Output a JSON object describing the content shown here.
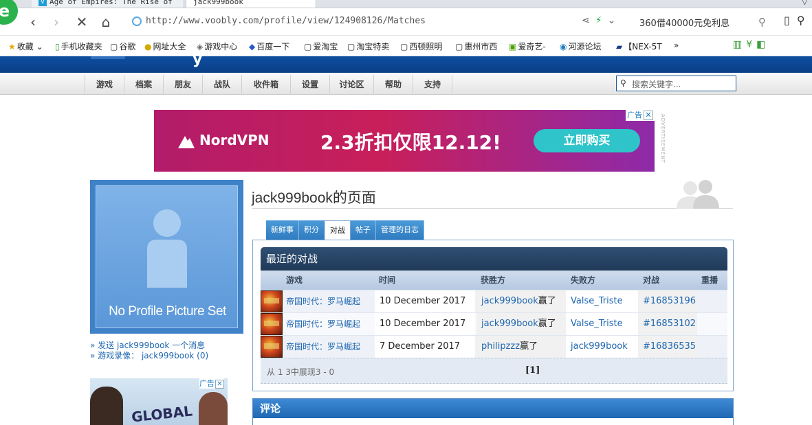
{
  "browser": {
    "tabs": [
      "Age of Empires: The Rise of",
      "jack999book"
    ],
    "address": "http://www.voobly.com/profile/view/124908126/Matches",
    "search_text": "360借40000元免利息",
    "bookmarks": [
      {
        "icon": "★",
        "label": "收藏"
      },
      {
        "icon": "▯",
        "label": "手机收藏夹"
      },
      {
        "icon": "▢",
        "label": "谷歌"
      },
      {
        "icon": "●",
        "label": "网址大全"
      },
      {
        "icon": "◈",
        "label": "游戏中心"
      },
      {
        "icon": "◆",
        "label": "百度一下"
      },
      {
        "icon": "▢",
        "label": "爱淘宝"
      },
      {
        "icon": "▢",
        "label": "淘宝特卖"
      },
      {
        "icon": "▢",
        "label": "西顿照明"
      },
      {
        "icon": "▢",
        "label": "惠州市西"
      },
      {
        "icon": "▣",
        "label": "爱奇艺-"
      },
      {
        "icon": "◉",
        "label": "河源论坛"
      },
      {
        "icon": "▰",
        "label": "【NEX-5T"
      }
    ],
    "more": "»"
  },
  "site": {
    "menu": [
      "游戏",
      "档案",
      "朋友",
      "战队",
      "收件箱",
      "设置",
      "讨论区",
      "帮助",
      "支持"
    ],
    "search_placeholder": "搜索关键字..."
  },
  "ad": {
    "brand": "NordVPN",
    "promo": "2.3折扣仅限12.12!",
    "button": "立即购买",
    "tag": "广告",
    "vertical": "ADVERTISEMENT",
    "ad2_text": "GLOBAL",
    "ad2_tag": "广告"
  },
  "profile": {
    "no_picture": "No Profile Picture Set",
    "links": [
      "» 发送 jack999book 一个消息",
      "» 游戏录像： jack999book (0)"
    ],
    "title": "jack999book的页面",
    "tabs": [
      "新鲜事",
      "积分",
      "对战",
      "帖子",
      "管理的日志"
    ],
    "active_tab": 2
  },
  "matches": {
    "header": "最近的对战",
    "columns": [
      "游戏",
      "时间",
      "获胜方",
      "失败方",
      "对战",
      "重播"
    ],
    "win_suffix": "赢了",
    "rows": [
      {
        "game": "帝国时代：罗马崛起",
        "time": "10 December 2017",
        "winner": "jack999book",
        "loser": "Valse_Triste",
        "match": "#16853196"
      },
      {
        "game": "帝国时代：罗马崛起",
        "time": "10 December 2017",
        "winner": "jack999book",
        "loser": "Valse_Triste",
        "match": "#16853102"
      },
      {
        "game": "帝国时代：罗马崛起",
        "time": "7 December 2017",
        "winner": "philipzzz",
        "loser": "jack999book",
        "match": "#16836535"
      }
    ],
    "footer_info": "从 1 3中展现3 - 0",
    "pagination": "[1]"
  },
  "comments": {
    "header": "评论"
  }
}
